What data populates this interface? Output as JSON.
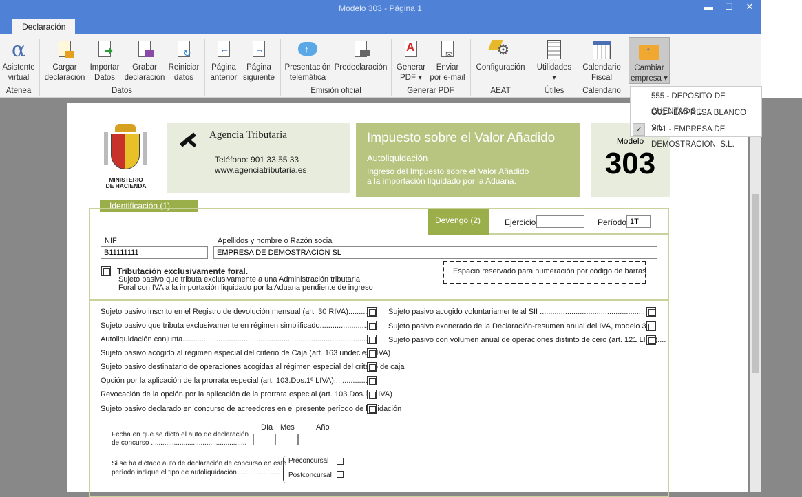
{
  "window": {
    "title": "Modelo 303 - Página 1",
    "minimize": "▬",
    "maximize": "☐",
    "close": "✕"
  },
  "tab": {
    "label": "Declaración"
  },
  "ribbon": {
    "buttons": [
      {
        "line1": "Asistente",
        "line2": "virtual"
      },
      {
        "line1": "Cargar",
        "line2": "declaración"
      },
      {
        "line1": "Importar",
        "line2": "Datos"
      },
      {
        "line1": "Grabar",
        "line2": "declaración"
      },
      {
        "line1": "Reiniciar",
        "line2": "datos"
      },
      {
        "line1": "Página",
        "line2": "anterior"
      },
      {
        "line1": "Página",
        "line2": "siguiente"
      },
      {
        "line1": "Presentación",
        "line2": "telemática"
      },
      {
        "line1": "Predeclaración",
        "line2": ""
      },
      {
        "line1": "Generar",
        "line2": "PDF ▾"
      },
      {
        "line1": "Enviar",
        "line2": "por e-mail"
      },
      {
        "line1": "Configuración",
        "line2": ""
      },
      {
        "line1": "Utilidades",
        "line2": "▾"
      },
      {
        "line1": "Calendario",
        "line2": "Fiscal"
      },
      {
        "line1": "Cambiar",
        "line2": "empresa ▾"
      }
    ],
    "groups": [
      "Atenea",
      "Datos",
      "Emisión oficial",
      "Generar PDF",
      "AEAT",
      "Útiles",
      "Calendario"
    ]
  },
  "company_menu": {
    "items": [
      "555 - DEPOSITO DE CUENTAS S.L.",
      "O01 - EMPRESA BLANCO S.L.",
      "XD1 - EMPRESA DE DEMOSTRACION, S.L."
    ],
    "check": "✓"
  },
  "form": {
    "ministry": [
      "MINISTERIO",
      "DE HACIENDA"
    ],
    "agency_name": "Agencia Tributaria",
    "agency_phone": "Teléfono: 901 33 55 33",
    "agency_web": "www.agenciatributaria.es",
    "tax_title": "Impuesto sobre el Valor Añadido",
    "tax_subtitle": "Autoliquidación",
    "tax_desc1": "Ingreso del Impuesto sobre el Valor Añadido",
    "tax_desc2": "a la importación liquidado por la Aduana.",
    "modelo_label": "Modelo",
    "modelo_number": "303",
    "section_ident": "Identificación (1)",
    "devengo": "Devengo (2)",
    "ejercicio_label": "Ejercicio",
    "ejercicio_value": "",
    "periodo_label": "Período",
    "periodo_value": "1T",
    "nif_label": "NIF",
    "nif_value": "B11111111",
    "name_label": "Apellidos y nombre o Razón social",
    "name_value": "EMPRESA DE DEMOSTRACION SL",
    "foral_title": "Tributación exclusivamente foral.",
    "foral_line1": "Sujeto pasivo que tributa exclusivamente a una Administración tributaria",
    "foral_line2": "Foral con IVA a la importación liquidado por la Aduana pendiente de ingreso",
    "barcode": "Espacio reservado para numeración por código de barras",
    "left_checks": [
      "Sujeto pasivo inscrito en el Registro de devolución mensual (art. 30 RIVA)..........",
      "Sujeto pasivo que tributa exclusivamente en régimen simplificado.......................",
      "Autoliquidación conjunta..........................................................................................",
      "Sujeto pasivo acogido al régimen especial del criterio de Caja (art. 163 undecies LIVA)",
      "Sujeto pasivo destinatario de operaciones acogidas al régimen especial del criterio de caja",
      "Opción por la aplicación de la prorrata especial (art. 103.Dos.1º LIVA).................",
      "Revocación de la opción por la aplicación de la prorrata especial (art. 103.Dos.1º LIVA)",
      "Sujeto pasivo declarado en concurso de acreedores en el presente período de liquidación"
    ],
    "right_checks": [
      "Sujeto pasivo acogido voluntariamente al SII ......................................................",
      "Sujeto pasivo exonerado de la Declaración-resumen anual del IVA, modelo 390",
      "Sujeto pasivo con volumen anual de operaciones distinto de cero (art. 121 LIVA)...."
    ],
    "date_day": "Día",
    "date_month": "Mes",
    "date_year": "Año",
    "concurso_date_1": "Fecha en que se dictó el auto de declaración",
    "concurso_date_2": "de concurso ..................................................",
    "concurso_type_1": "Si se ha dictado auto de declaración de concurso en este",
    "concurso_type_2": "período indique el tipo de autoliquidación ........................",
    "preconcursal": "Preconcursal",
    "postconcursal": "Postconcursal"
  }
}
